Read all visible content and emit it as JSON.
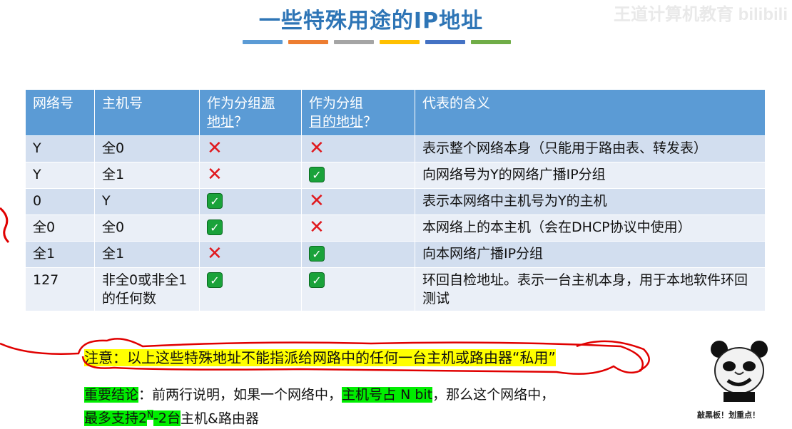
{
  "title": "一些特殊用途的IP地址",
  "watermark": "王道计算机教育 bilibili",
  "color_bars": [
    "#5b9bd5",
    "#ed7d31",
    "#a5a5a5",
    "#ffc000",
    "#4472c4",
    "#70ad47"
  ],
  "table": {
    "headers": {
      "c1": "网络号",
      "c2": "主机号",
      "c3a": "作为分组",
      "c3b": "源",
      "c3c": "地址",
      "c3d": "？",
      "c4a": "作为分组",
      "c4b": "目的地址",
      "c4c": "？",
      "c5": "代表的含义"
    },
    "rows": [
      {
        "net": "Y",
        "host": "全0",
        "src": "cross",
        "dst": "cross",
        "meaning": "表示整个网络本身（只能用于路由表、转发表）"
      },
      {
        "net": "Y",
        "host": "全1",
        "src": "cross",
        "dst": "check",
        "meaning": "向网络号为Y的网络广播IP分组"
      },
      {
        "net": "0",
        "host": "Y",
        "src": "check",
        "dst": "cross",
        "meaning": "表示本网络中主机号为Y的主机"
      },
      {
        "net": "全0",
        "host": "全0",
        "src": "check",
        "dst": "cross",
        "meaning": "本网络上的本主机（会在DHCP协议中使用）"
      },
      {
        "net": "全1",
        "host": "全1",
        "src": "cross",
        "dst": "check",
        "meaning": "向本网络广播IP分组"
      },
      {
        "net": "127",
        "host": "非全0或非全1的任何数",
        "src": "check",
        "dst": "check",
        "meaning": "环回自检地址。表示一台主机本身，用于本地软件环回测试"
      }
    ]
  },
  "note": {
    "label": "注意",
    "colon": "：",
    "text": "以上这些特殊地址不能指派给网路中的任何一台主机或路由器",
    "tail": "“私用”"
  },
  "conclusion": {
    "label": "重要结论",
    "part1": "：前两行说明，如果一个网络中，",
    "highlight": "主机号占 N bit",
    "part2": "，那么这个网络中，",
    "line2_hl_pre": "最多支持2",
    "line2_sup": "N",
    "line2_hl_post": "-2台",
    "line2_rest": "主机&路由器"
  },
  "sticker_caption": "敲黑板！划重点！",
  "icons": {
    "check": "check-icon",
    "cross": "cross-icon"
  }
}
